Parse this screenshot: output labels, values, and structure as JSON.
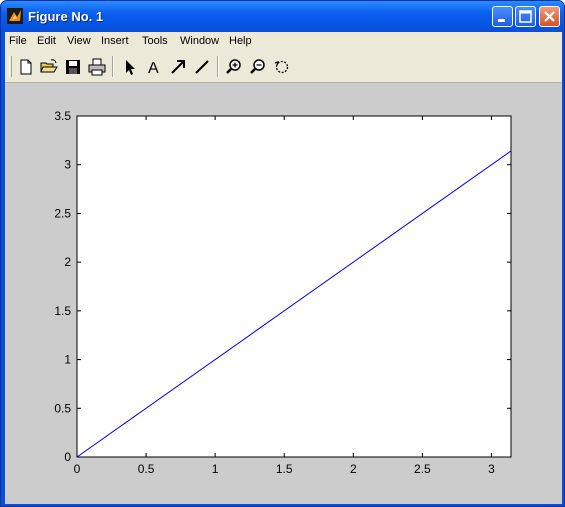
{
  "window": {
    "title": "Figure No. 1",
    "app_icon": "matlab-icon"
  },
  "menu": {
    "items": [
      "File",
      "Edit",
      "View",
      "Insert",
      "Tools",
      "Window",
      "Help"
    ]
  },
  "toolbar": {
    "icons": [
      "new-file-icon",
      "open-folder-icon",
      "save-icon",
      "print-icon",
      "arrow-select-icon",
      "text-icon",
      "arrow-icon",
      "line-icon",
      "zoom-in-icon",
      "zoom-out-icon",
      "rotate-icon"
    ]
  },
  "colors": {
    "line": "#0000ff",
    "figure_bg": "#cccccc",
    "axes_bg": "#ffffff"
  },
  "chart_data": {
    "type": "line",
    "title": "",
    "xlabel": "",
    "ylabel": "",
    "xlim": [
      0,
      3.1416
    ],
    "ylim": [
      0,
      3.5
    ],
    "xticks": [
      0,
      0.5,
      1,
      1.5,
      2,
      2.5,
      3
    ],
    "xtick_labels": [
      "0",
      "0.5",
      "1",
      "1.5",
      "2",
      "2.5",
      "3"
    ],
    "yticks": [
      0,
      0.5,
      1,
      1.5,
      2,
      2.5,
      3,
      3.5
    ],
    "ytick_labels": [
      "0",
      "0.5",
      "1",
      "1.5",
      "2",
      "2.5",
      "3",
      "3.5"
    ],
    "grid": false,
    "series": [
      {
        "x": [
          0,
          3.1416
        ],
        "y": [
          0,
          3.1416
        ],
        "color": "#0000ff"
      }
    ]
  }
}
